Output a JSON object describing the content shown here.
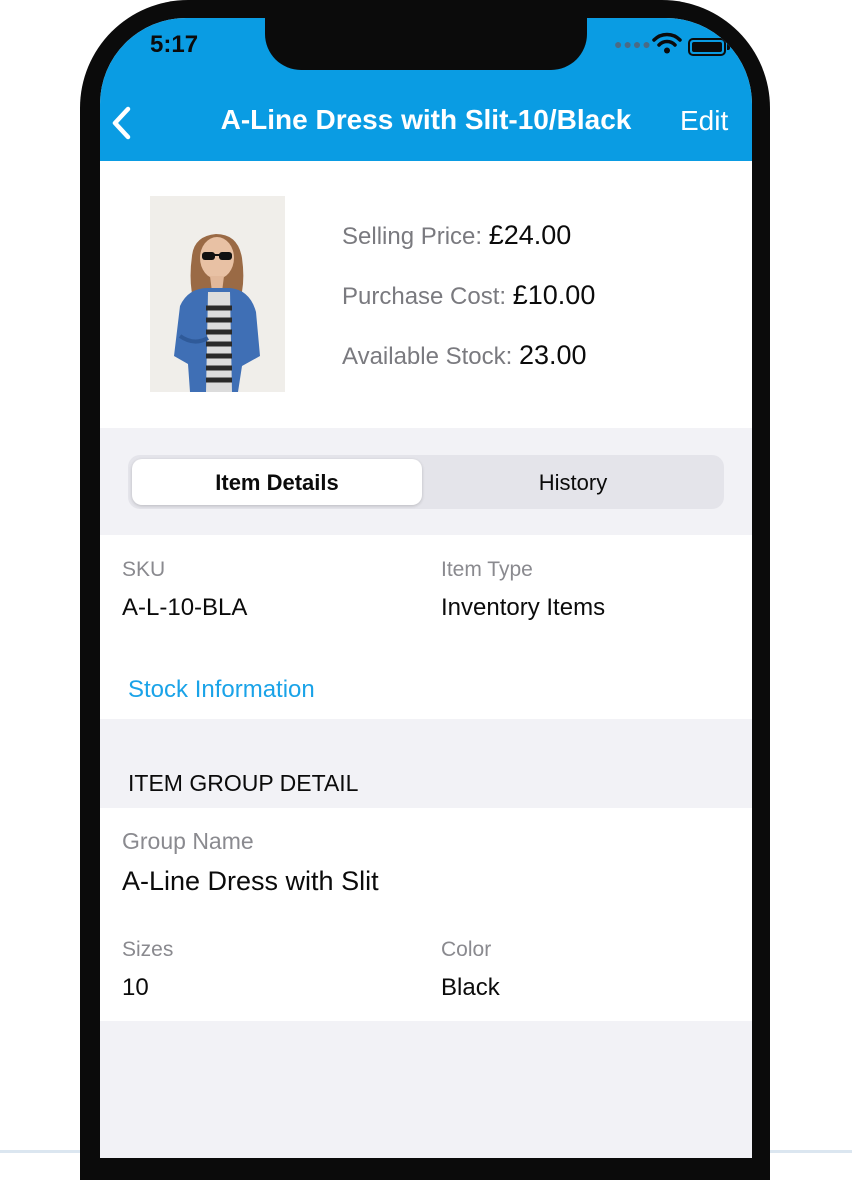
{
  "status_bar": {
    "time": "5:17"
  },
  "nav": {
    "title": "A-Line Dress with Slit-10/Black",
    "edit_label": "Edit"
  },
  "summary": {
    "selling_price_label": "Selling Price:",
    "selling_price_value": "£24.00",
    "purchase_cost_label": "Purchase Cost:",
    "purchase_cost_value": "£10.00",
    "available_stock_label": "Available Stock:",
    "available_stock_value": "23.00"
  },
  "tabs": [
    {
      "label": "Item Details",
      "active": true
    },
    {
      "label": "History",
      "active": false
    }
  ],
  "details": {
    "sku_label": "SKU",
    "sku_value": "A-L-10-BLA",
    "item_type_label": "Item Type",
    "item_type_value": "Inventory Items",
    "stock_link": "Stock Information"
  },
  "group": {
    "section_title": "ITEM GROUP DETAIL",
    "group_name_label": "Group Name",
    "group_name_value": "A-Line Dress with Slit",
    "sizes_label": "Sizes",
    "sizes_value": "10",
    "color_label": "Color",
    "color_value": "Black"
  },
  "colors": {
    "accent": "#0a9ce3",
    "link": "#1aa3e8"
  },
  "icons": [
    "back-chevron-icon",
    "wifi-icon",
    "battery-icon",
    "signal-dots-icon"
  ]
}
